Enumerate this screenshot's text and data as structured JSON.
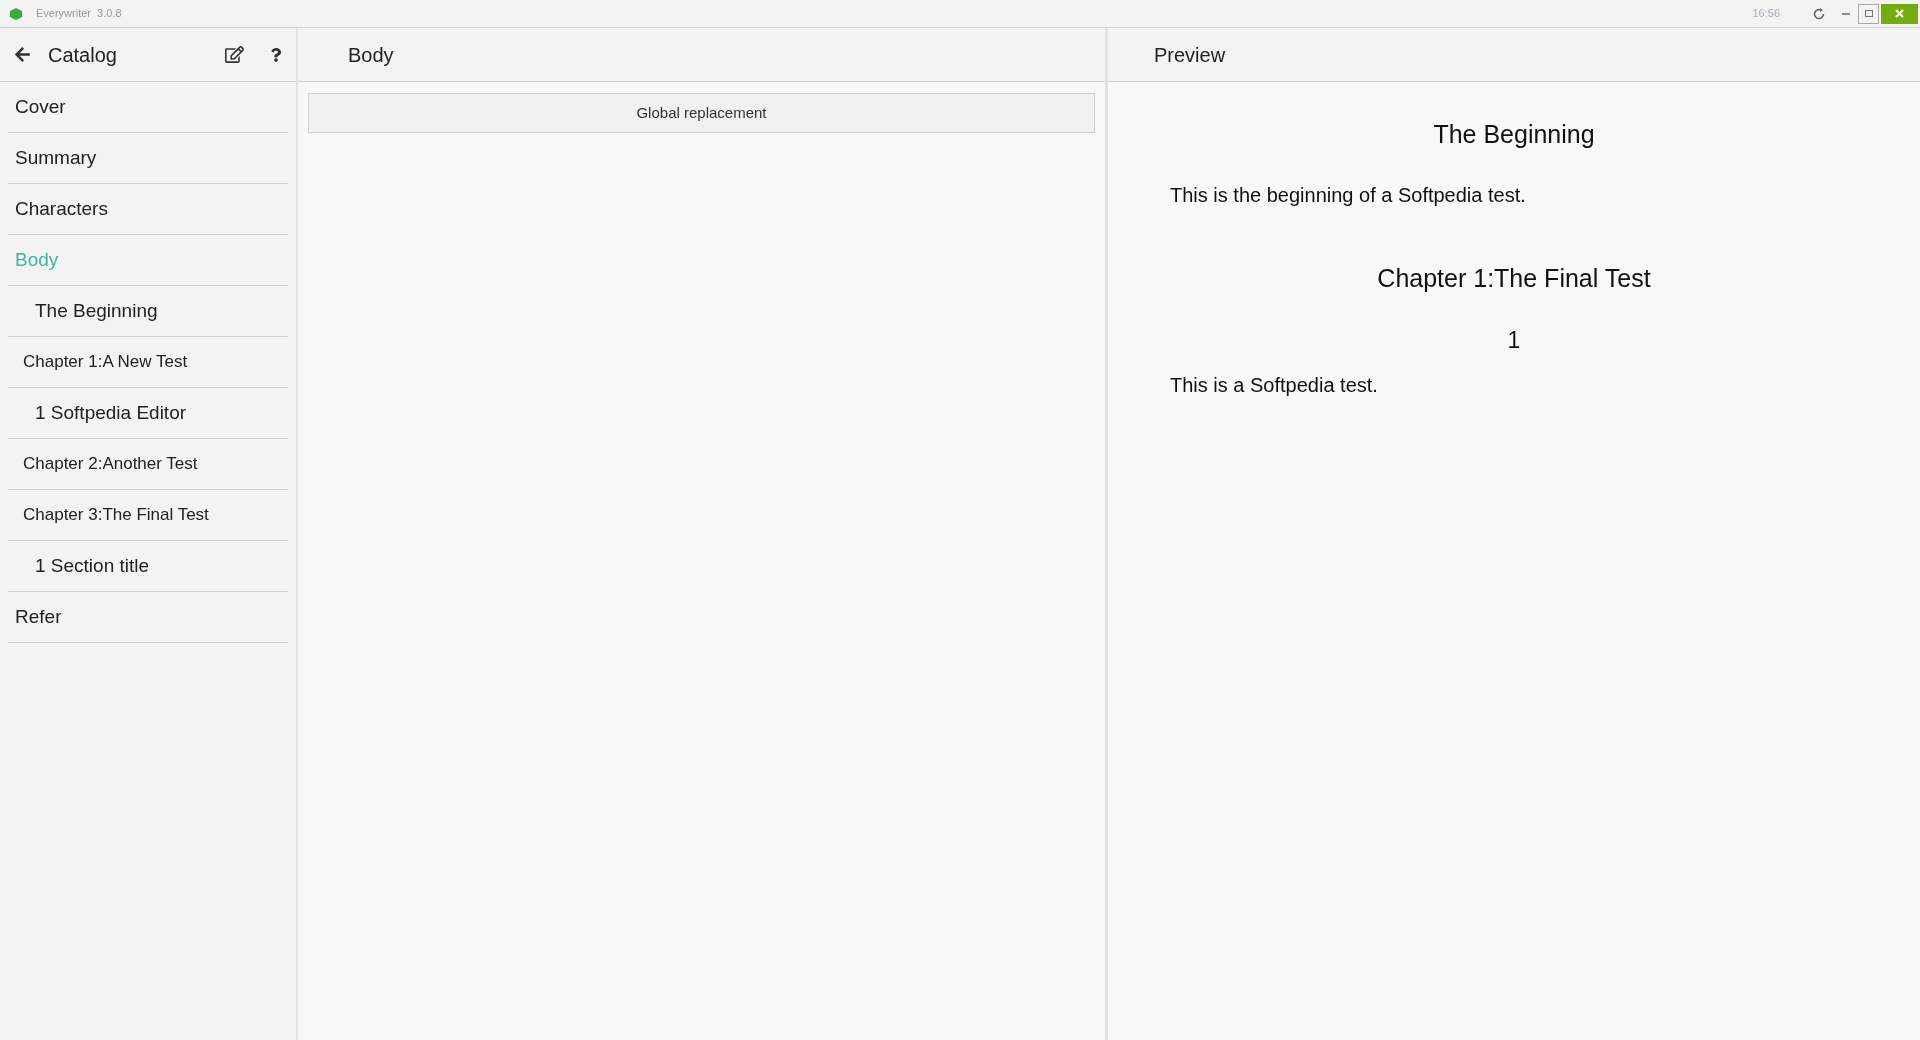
{
  "window": {
    "title": "Everywriter  3.0.8",
    "time": "16:56"
  },
  "sidebar": {
    "title": "Catalog",
    "items": [
      {
        "label": "Cover",
        "kind": "top",
        "selected": false
      },
      {
        "label": "Summary",
        "kind": "top",
        "selected": false
      },
      {
        "label": "Characters",
        "kind": "top",
        "selected": false
      },
      {
        "label": "Body",
        "kind": "top",
        "selected": true,
        "children": [
          {
            "label": "The Beginning",
            "kind": "section",
            "selected": false
          },
          {
            "label": "Chapter 1:A New Test",
            "kind": "chapter",
            "selected": false,
            "children": [
              {
                "label": "1 Softpedia Editor",
                "kind": "section",
                "selected": false
              }
            ]
          },
          {
            "label": "Chapter 2:Another Test",
            "kind": "chapter",
            "selected": false
          },
          {
            "label": "Chapter 3:The Final Test",
            "kind": "chapter",
            "selected": false,
            "children": [
              {
                "label": "1 Section title",
                "kind": "section",
                "selected": false
              }
            ]
          }
        ]
      },
      {
        "label": "Refer",
        "kind": "top",
        "selected": false
      }
    ]
  },
  "editor": {
    "title": "Body",
    "button": "Global replacement"
  },
  "preview": {
    "title": "Preview",
    "blocks": [
      {
        "kind": "heading",
        "text": "The Beginning"
      },
      {
        "kind": "paragraph",
        "text": "This is the beginning of a Softpedia test."
      },
      {
        "kind": "heading",
        "text": "Chapter 1:The Final Test"
      },
      {
        "kind": "number",
        "text": "1"
      },
      {
        "kind": "paragraph",
        "text": "This is a Softpedia test."
      }
    ]
  }
}
